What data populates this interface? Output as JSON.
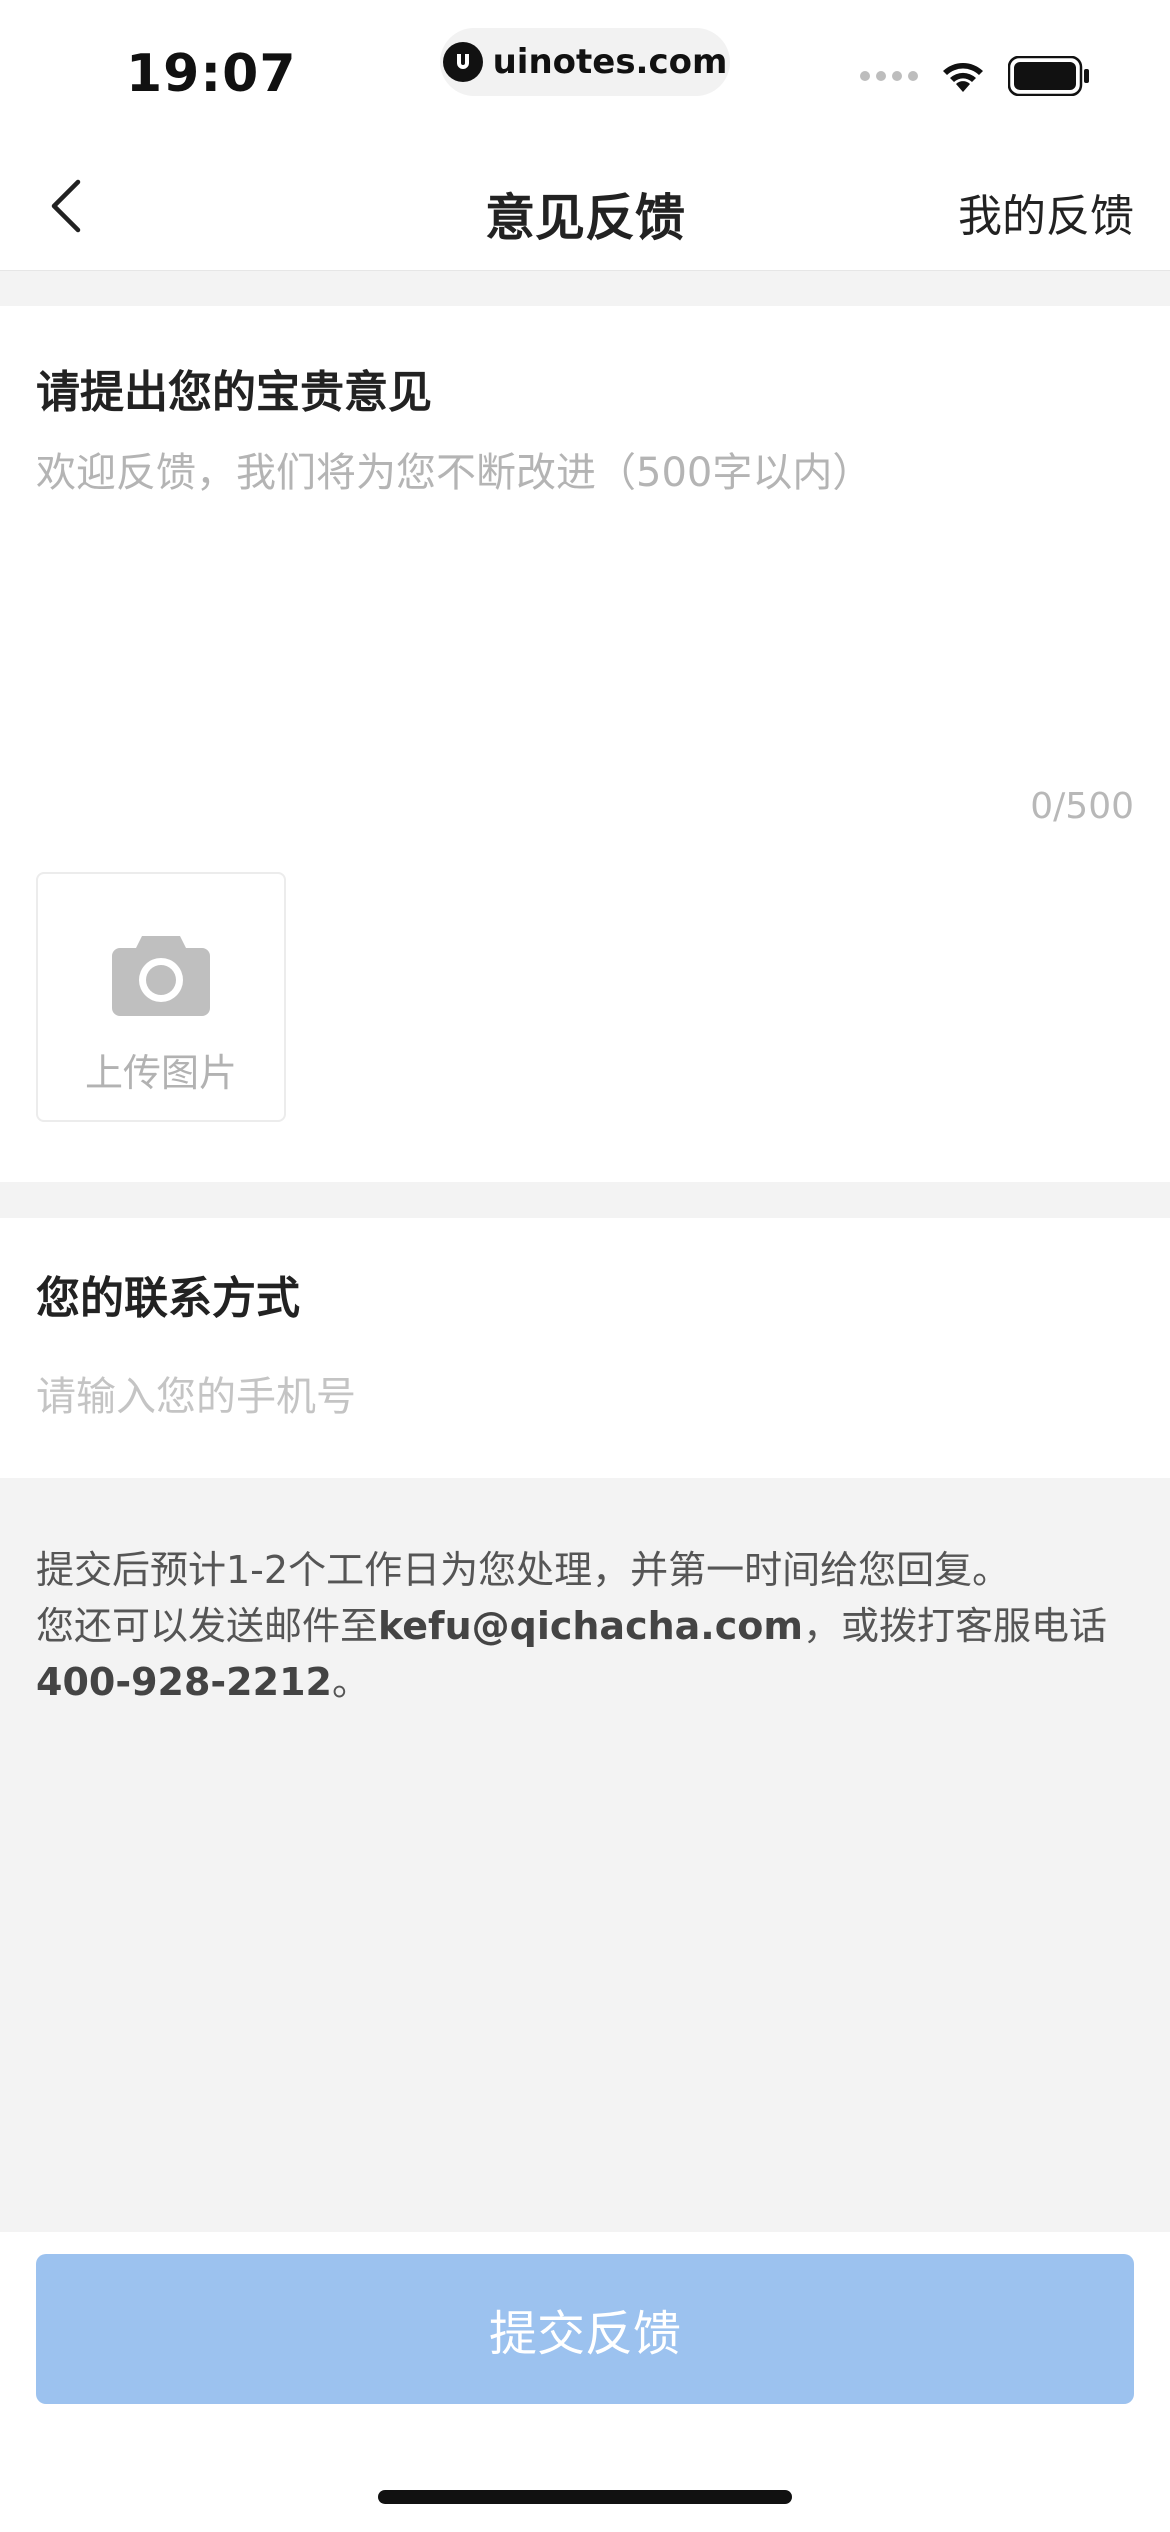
{
  "status_bar": {
    "time": "19:07",
    "url": "uinotes.com"
  },
  "nav": {
    "title": "意见反馈",
    "right_link": "我的反馈",
    "back_icon": "chevron-left-icon"
  },
  "feedback": {
    "title": "请提出您的宝贵意见",
    "placeholder": "欢迎反馈，我们将为您不断改进（500字以内）",
    "counter": "0/500",
    "upload_label": "上传图片",
    "upload_icon": "camera-icon"
  },
  "contact": {
    "title": "您的联系方式",
    "placeholder": "请输入您的手机号"
  },
  "info": {
    "line1": "提交后预计1-2个工作日为您处理，并第一时间给您回复。",
    "line2_prefix": "您还可以发送邮件至",
    "email": "kefu@qichacha.com",
    "line2_suffix": "，或拨打客服电话",
    "phone": "400-928-2212",
    "end": "。"
  },
  "submit": {
    "label": "提交反馈"
  },
  "colors": {
    "primary_disabled": "#9cc2ef",
    "background": "#f3f3f3"
  }
}
